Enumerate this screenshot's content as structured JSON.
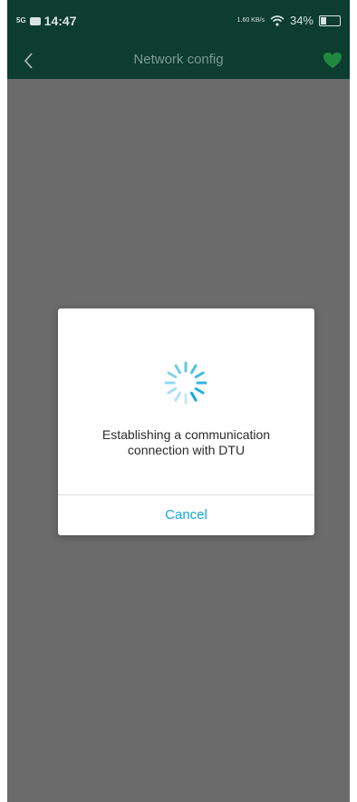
{
  "status_bar": {
    "network": "5G",
    "time": "14:47",
    "speed": "1.60 KB/s",
    "battery": "34%"
  },
  "navbar": {
    "title": "Network config",
    "back_icon": "chevron-left-icon",
    "favorite_icon": "heart-icon"
  },
  "dialog": {
    "spinner_icon": "loading-spinner-icon",
    "message_line1": "Establishing a communication",
    "message_line2": "connection with DTU",
    "cancel_label": "Cancel"
  },
  "colors": {
    "header_bg": "#0c3d2f",
    "overlay_bg": "#6b6b6b",
    "accent": "#10a9dc",
    "heart": "#1f8a3f"
  }
}
